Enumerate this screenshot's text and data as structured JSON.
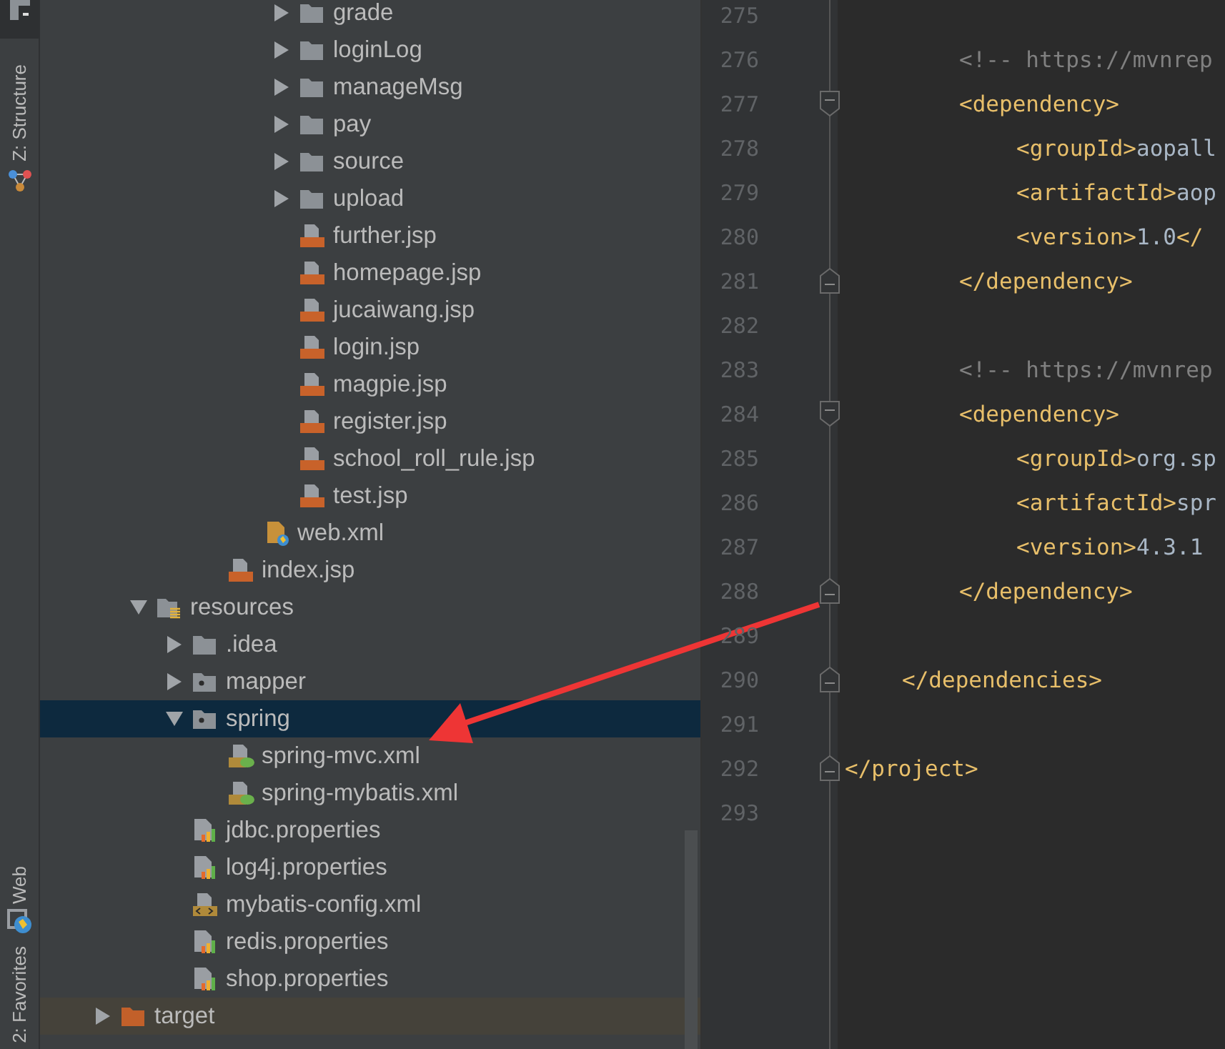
{
  "tool_strip": [
    {
      "label": "Z: Structure",
      "kind": "structure"
    },
    {
      "label": "Web",
      "kind": "web"
    },
    {
      "label": "2: Favorites",
      "kind": "favorites"
    }
  ],
  "project_tree": [
    {
      "children": [
        {
          "children": [
            {
              "children": [
                {
                  "children": [
                    {
                      "children": [
                        {
                          "label": "grade",
                          "kind": "folder",
                          "expanded": false,
                          "selected": false
                        },
                        {
                          "label": "loginLog",
                          "kind": "folder",
                          "expanded": false,
                          "selected": false
                        },
                        {
                          "label": "manageMsg",
                          "kind": "folder",
                          "expanded": false,
                          "selected": false
                        },
                        {
                          "label": "pay",
                          "kind": "folder",
                          "expanded": false,
                          "selected": false
                        },
                        {
                          "label": "source",
                          "kind": "folder",
                          "expanded": false,
                          "selected": false
                        },
                        {
                          "label": "upload",
                          "kind": "folder",
                          "expanded": false,
                          "selected": false
                        },
                        {
                          "label": "further.jsp",
                          "kind": "jsp",
                          "selected": false
                        },
                        {
                          "label": "homepage.jsp",
                          "kind": "jsp",
                          "selected": false
                        },
                        {
                          "label": "jucaiwang.jsp",
                          "kind": "jsp",
                          "selected": false
                        },
                        {
                          "label": "login.jsp",
                          "kind": "jsp",
                          "selected": false
                        },
                        {
                          "label": "magpie.jsp",
                          "kind": "jsp",
                          "selected": false
                        },
                        {
                          "label": "register.jsp",
                          "kind": "jsp",
                          "selected": false
                        },
                        {
                          "label": "school_roll_rule.jsp",
                          "kind": "jsp",
                          "selected": false
                        },
                        {
                          "label": "test.jsp",
                          "kind": "jsp",
                          "selected": false
                        }
                      ]
                    },
                    {
                      "label": "web.xml",
                      "kind": "webxml",
                      "selected": false
                    }
                  ]
                },
                {
                  "label": "index.jsp",
                  "kind": "jsp",
                  "selected": false
                }
              ]
            }
          ]
        },
        {
          "label": "resources",
          "kind": "resources",
          "expanded": true,
          "selected": false,
          "children": [
            {
              "label": ".idea",
              "kind": "folder",
              "expanded": false,
              "selected": false
            },
            {
              "label": "mapper",
              "kind": "package",
              "expanded": false,
              "selected": false
            },
            {
              "label": "spring",
              "kind": "package",
              "expanded": true,
              "selected": true,
              "children": [
                {
                  "label": "spring-mvc.xml",
                  "kind": "springxml",
                  "selected": false
                },
                {
                  "label": "spring-mybatis.xml",
                  "kind": "springxml",
                  "selected": false
                }
              ]
            },
            {
              "label": "jdbc.properties",
              "kind": "properties",
              "selected": false
            },
            {
              "label": "log4j.properties",
              "kind": "properties",
              "selected": false
            },
            {
              "label": "mybatis-config.xml",
              "kind": "xml",
              "selected": false
            },
            {
              "label": "redis.properties",
              "kind": "properties",
              "selected": false
            },
            {
              "label": "shop.properties",
              "kind": "properties",
              "selected": false
            }
          ]
        }
      ]
    },
    {
      "label": "target",
      "kind": "excluded",
      "expanded": false,
      "selected": false
    }
  ],
  "editor_lines": [
    {
      "number": "275"
    },
    {
      "children": [
        {
          "children": [
            {
              "number": "276",
              "tokens": [
                {
                  "kind": "comment",
                  "text": "<!-- https://mvnrep"
                }
              ]
            },
            {
              "number": "277",
              "kind": "fold-start",
              "tokens": [
                {
                  "kind": "tag",
                  "text": "<dependency>"
                }
              ],
              "children": [
                {
                  "number": "278",
                  "tokens": [
                    {
                      "kind": "tag",
                      "text": "<groupId>"
                    },
                    {
                      "kind": "value",
                      "text": "aopall"
                    }
                  ]
                },
                {
                  "number": "279",
                  "tokens": [
                    {
                      "kind": "tag",
                      "text": "<artifactId>"
                    },
                    {
                      "kind": "value",
                      "text": "aop"
                    }
                  ]
                },
                {
                  "number": "280",
                  "tokens": [
                    {
                      "kind": "tag",
                      "text": "<version>"
                    },
                    {
                      "kind": "value",
                      "text": "1.0"
                    },
                    {
                      "kind": "tag",
                      "text": "</"
                    }
                  ]
                }
              ]
            },
            {
              "number": "281",
              "kind": "fold-end",
              "tokens": [
                {
                  "kind": "tag",
                  "text": "</dependency>"
                }
              ]
            },
            {
              "number": "282"
            },
            {
              "number": "283",
              "tokens": [
                {
                  "kind": "comment",
                  "text": "<!-- https://mvnrep"
                }
              ]
            },
            {
              "number": "284",
              "kind": "fold-start",
              "tokens": [
                {
                  "kind": "tag",
                  "text": "<dependency>"
                }
              ],
              "children": [
                {
                  "number": "285",
                  "tokens": [
                    {
                      "kind": "tag",
                      "text": "<groupId>"
                    },
                    {
                      "kind": "value",
                      "text": "org.sp"
                    }
                  ]
                },
                {
                  "number": "286",
                  "tokens": [
                    {
                      "kind": "tag",
                      "text": "<artifactId>"
                    },
                    {
                      "kind": "value",
                      "text": "spr"
                    }
                  ]
                },
                {
                  "number": "287",
                  "tokens": [
                    {
                      "kind": "tag",
                      "text": "<version>"
                    },
                    {
                      "kind": "value",
                      "text": "4.3.1"
                    }
                  ]
                }
              ]
            },
            {
              "number": "288",
              "kind": "fold-end",
              "tokens": [
                {
                  "kind": "tag",
                  "text": "</dependency>"
                }
              ]
            },
            {
              "number": "289"
            }
          ]
        },
        {
          "number": "290",
          "kind": "fold-end",
          "tokens": [
            {
              "kind": "tag",
              "text": "</dependencies>"
            }
          ]
        },
        {
          "number": "291"
        }
      ]
    },
    {
      "number": "292",
      "kind": "fold-end",
      "tokens": [
        {
          "kind": "tag",
          "text": "</project>"
        }
      ]
    },
    {
      "number": "293"
    }
  ]
}
